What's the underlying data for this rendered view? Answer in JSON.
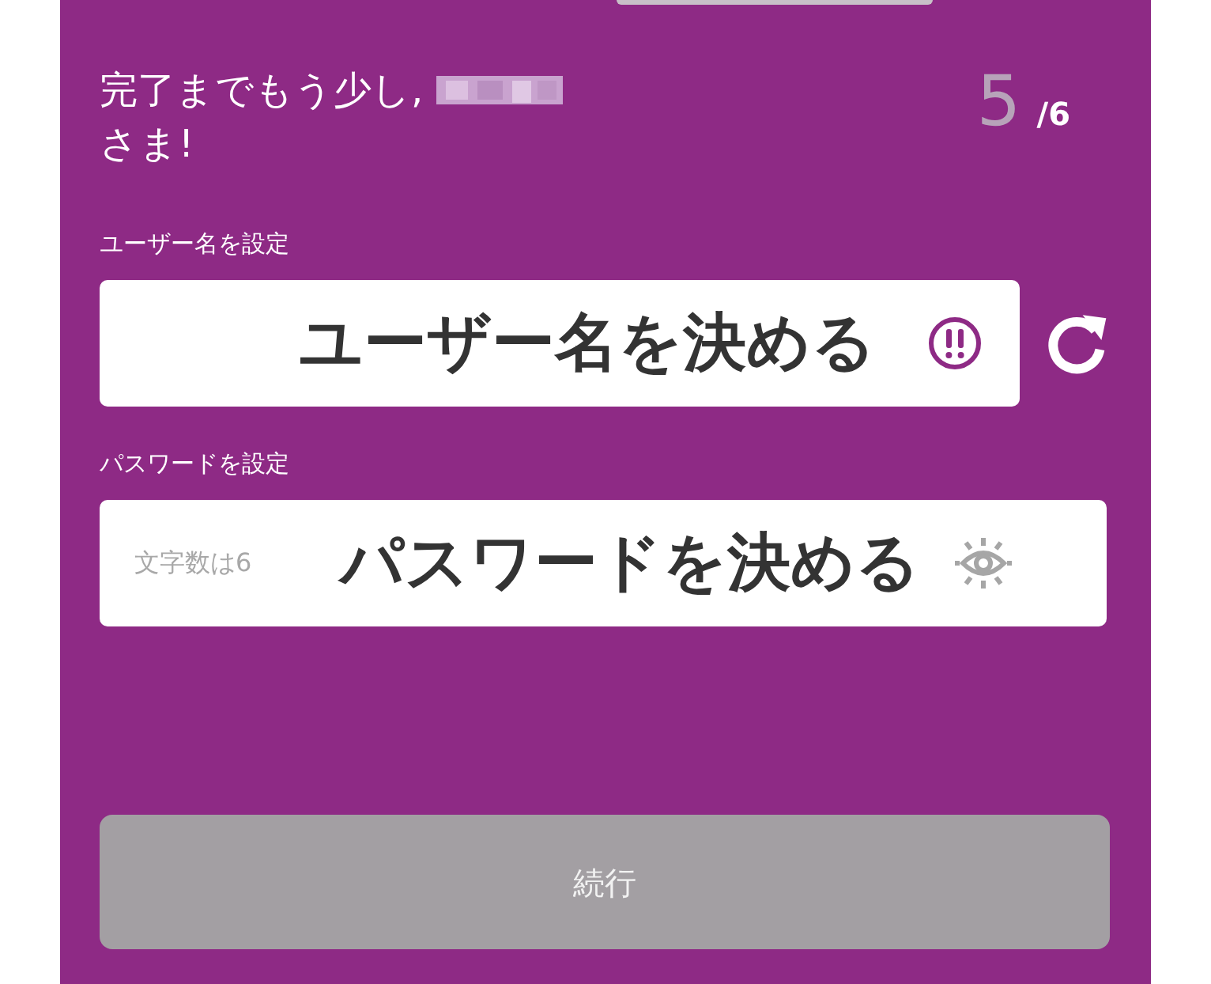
{
  "header": {
    "greeting_line1": "完了までもう少し,",
    "greeting_line2": "さま!",
    "step_current": "5",
    "step_total": "/6"
  },
  "fields": [
    {
      "kind": "username",
      "label": "ユーザー名を設定",
      "overlay": "ユーザー名を決める"
    },
    {
      "kind": "password",
      "label": "パスワードを設定",
      "placeholder": "文字数は6",
      "overlay": "パスワードを決める"
    }
  ],
  "continue_button": {
    "label": "続行",
    "disabled": true
  }
}
